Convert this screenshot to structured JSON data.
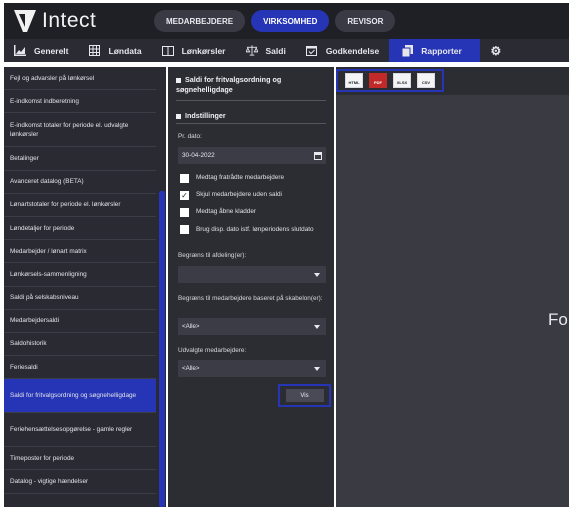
{
  "header": {
    "logo_text": "Intect",
    "tabs": [
      {
        "label": "MEDARBEJDERE",
        "active": false
      },
      {
        "label": "VIRKSOMHED",
        "active": true
      },
      {
        "label": "REVISOR",
        "active": false
      }
    ]
  },
  "navbar": {
    "items": [
      {
        "label": "Generelt",
        "icon": "chart-icon",
        "active": false
      },
      {
        "label": "Løndata",
        "icon": "grid-icon",
        "active": false
      },
      {
        "label": "Lønkørsler",
        "icon": "book-icon",
        "active": false
      },
      {
        "label": "Saldi",
        "icon": "scale-icon",
        "active": false
      },
      {
        "label": "Godkendelse",
        "icon": "calendar-check-icon",
        "active": false
      },
      {
        "label": "Rapporter",
        "icon": "documents-icon",
        "active": true
      },
      {
        "label": "",
        "icon": "gear-icon",
        "active": false
      }
    ]
  },
  "sidebar": {
    "items": [
      {
        "label": "Fejl og advarsler på lønkørsel"
      },
      {
        "label": "E-indkomst indberetning"
      },
      {
        "label": "E-indkomst totaler for periode el. udvalgte lønkørsler"
      },
      {
        "label": "Betalinger"
      },
      {
        "label": "Avanceret datalog (BETA)"
      },
      {
        "label": "Lønartstotaler for periode el. lønkørsler"
      },
      {
        "label": "Løndetaljer for periode"
      },
      {
        "label": "Medarbejder / lønart matrix"
      },
      {
        "label": "Lønkørsels-sammenligning"
      },
      {
        "label": "Saldi på selskabsniveau"
      },
      {
        "label": "Medarbejdersaldi"
      },
      {
        "label": "Saldohistorik"
      },
      {
        "label": "Feriesaldi"
      },
      {
        "label": "Saldi for fritvalgsordning og søgnehelligdage"
      },
      {
        "label": "Feriehensættelsesopgørelse - gamle regler"
      },
      {
        "label": "Timeposter for periode"
      },
      {
        "label": "Datalog - vigtige hændelser"
      }
    ],
    "active_index": 13
  },
  "panel": {
    "title": "Saldi for fritvalgsordning og søgnehelligdage",
    "settings_title": "Indstillinger",
    "date_label": "Pr. dato:",
    "date_value": "30-04-2022",
    "checkboxes": [
      {
        "label": "Medtag fratrådte medarbejdere",
        "checked": false
      },
      {
        "label": "Skjul medarbejdere uden saldi",
        "checked": true
      },
      {
        "label": "Medtag åbne kladder",
        "checked": false
      },
      {
        "label": "Brug disp. dato istf. lønperiodens slutdato",
        "checked": false
      }
    ],
    "dept_label": "Begræns til afdeling(er):",
    "dept_value": "",
    "template_label": "Begræns til medarbejdere baseret på skabelon(er):",
    "template_value": "<Alle>",
    "employees_label": "Udvalgte medarbejdere:",
    "employees_value": "<Alle>",
    "show_button": "Vis"
  },
  "report": {
    "exports": [
      {
        "label": "HTML",
        "icon": "html-file-icon"
      },
      {
        "label": "PDF",
        "icon": "pdf-file-icon"
      },
      {
        "label": "XLSX",
        "icon": "xlsx-file-icon"
      },
      {
        "label": "CSV",
        "icon": "csv-file-icon"
      }
    ],
    "view_text": "For"
  },
  "colors": {
    "accent": "#2535b5",
    "header_bg": "#1f1f26",
    "panel_bg": "#2c2c33",
    "pdf_red": "#c22a2a"
  }
}
